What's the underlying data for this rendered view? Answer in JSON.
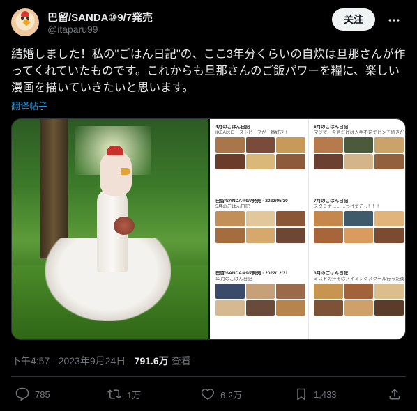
{
  "user": {
    "display_name": "巴留/SANDA⑩9/7発売",
    "handle": "@itaparu99"
  },
  "follow_button": "关注",
  "tweet": {
    "text": "結婚しました！私の\"ごはん日記\"の、ここ3年分くらいの自炊は旦那さんが作ってくれていたものです。これからも旦那さんのご飯パワーを糧に、楽しい漫画を描いていきたいと思います。",
    "translate_link": "翻译帖子"
  },
  "collage": {
    "cards": [
      {
        "title": "4月のごはん日記",
        "subtitle": "IKEAはローストビーフが一番好き!!"
      },
      {
        "title": "6月のごはん日記",
        "subtitle": "マジで、今月だけは人手不足でピンチ続きだった…"
      },
      {
        "title": "巴留/SANDA⑩9/7発売 · 2022/05/30",
        "subtitle": "5月のごはん日記"
      },
      {
        "title": "7月のごはん日記",
        "subtitle": "スタミナ………つけてこっ！！！"
      },
      {
        "title": "巴留/SANDA⑩9/7発売 · 2022/12/31",
        "subtitle": "12月のごはん日記"
      },
      {
        "title": "3月のごはん日記",
        "subtitle": "ミスドの汁そばスイミングスクール行った後よく食べてたから、懐かしい味"
      }
    ]
  },
  "meta": {
    "time": "下午4:57",
    "date": "2023年9月24日",
    "views": "791.6万",
    "views_label": "查看"
  },
  "actions": {
    "reply_count": "785",
    "repost_count": "1万",
    "like_count": "6.2万",
    "bookmark_count": "1,433"
  },
  "colors": {
    "background": "#000000",
    "text": "#e7e9ea",
    "muted": "#71767b",
    "link": "#1d9bf0"
  }
}
